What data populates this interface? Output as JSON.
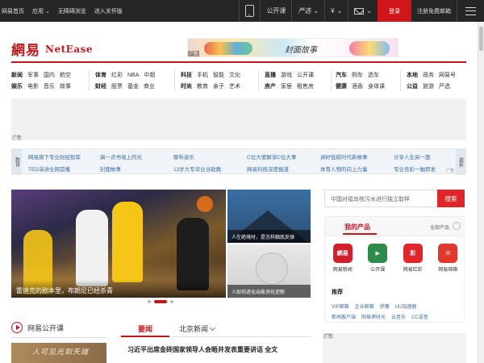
{
  "topbar": {
    "left": [
      "网易首页",
      "应用 ⌄",
      "无障碍浏览",
      "进入关怀版"
    ],
    "app_label": "公开课",
    "youxuan_label": "严选",
    "yen_label": "¥",
    "login": "登录",
    "register": "注册免费邮箱"
  },
  "logo": {
    "cn": "網易",
    "en": "NetEase"
  },
  "banner": {
    "tag": "广告",
    "title": "封面故事"
  },
  "nav": {
    "groups": [
      {
        "rows": [
          [
            "新闻",
            "军事",
            "国内",
            "航空"
          ],
          [
            "娱乐",
            "电影",
            "音乐",
            "故事"
          ]
        ]
      },
      {
        "rows": [
          [
            "体育",
            "红彩",
            "NBA",
            "中超"
          ],
          [
            "财经",
            "股票",
            "基金",
            "商业"
          ]
        ]
      },
      {
        "rows": [
          [
            "科技",
            "手机",
            "智能",
            "文化"
          ],
          [
            "时尚",
            "教育",
            "亲子",
            "艺术"
          ]
        ]
      },
      {
        "rows": [
          [
            "直播",
            "游戏",
            "公开课"
          ],
          [
            "房产",
            "家居",
            "租售房"
          ]
        ]
      },
      {
        "rows": [
          [
            "汽车",
            "购车",
            "选车"
          ],
          [
            "健康",
            "酒香",
            "身体课"
          ]
        ]
      },
      {
        "rows": [
          [
            "本地",
            "政务",
            "网易号"
          ],
          [
            "公益",
            "旅游",
            "严选"
          ]
        ]
      }
    ]
  },
  "ad_block": {
    "tag": "广告"
  },
  "links": {
    "left_label": "教育",
    "right_label": "最新",
    "ad_tag": "广告",
    "rows": [
      [
        "网易旗下专业财经智库",
        "搞一点书墙上的光",
        "聊听音乐",
        "C位大使解读C位大事",
        "讲好低碳时代新故事",
        "分享人生另一面"
      ],
      [
        "TED演讲全网首播",
        "封面故事",
        "13岁大专毕业当助教",
        "网易科技深度报道",
        "体育人物的向上力量",
        "专业竞彩一触即发"
      ]
    ]
  },
  "hero": {
    "caption": "雷迪克的剧本里，布朗尼已经杀青"
  },
  "side": [
    {
      "caption": "人在绝境时，是怎样触底反弹"
    },
    {
      "caption": "人如何进化出能消化逆粉"
    }
  ],
  "search": {
    "placeholder": "中国对福岛核污水进行独立取样",
    "button": "搜索"
  },
  "products": {
    "title": "我的产品",
    "all": "全部产品",
    "apps": [
      {
        "label": "网易新闻",
        "glyph": "網易",
        "color": "#d21f2a"
      },
      {
        "label": "公开课",
        "glyph": "▶",
        "color": "#2e8b4a"
      },
      {
        "label": "网易红彩",
        "glyph": "彩",
        "color": "#e0262a"
      },
      {
        "label": "网易邮箱",
        "glyph": "✉",
        "color": "#e0392b"
      }
    ],
    "recommend": "推荐",
    "rec_rows": [
      [
        "VIP邮箱",
        "企业邮箱",
        "伏羲",
        "UU加速器"
      ],
      [
        "新闻客户端",
        "网易承时光",
        "云音乐",
        "CC语音"
      ]
    ]
  },
  "ad2": {
    "tag": "广告"
  },
  "open_course": {
    "title": "网易公开课",
    "img_text": "人可见光到天燧"
  },
  "news": {
    "tab1": "要闻",
    "tab2": "北京新闻",
    "headline": "习近平出席金砖国家领导人会晤并发表重要讲话 全文"
  }
}
